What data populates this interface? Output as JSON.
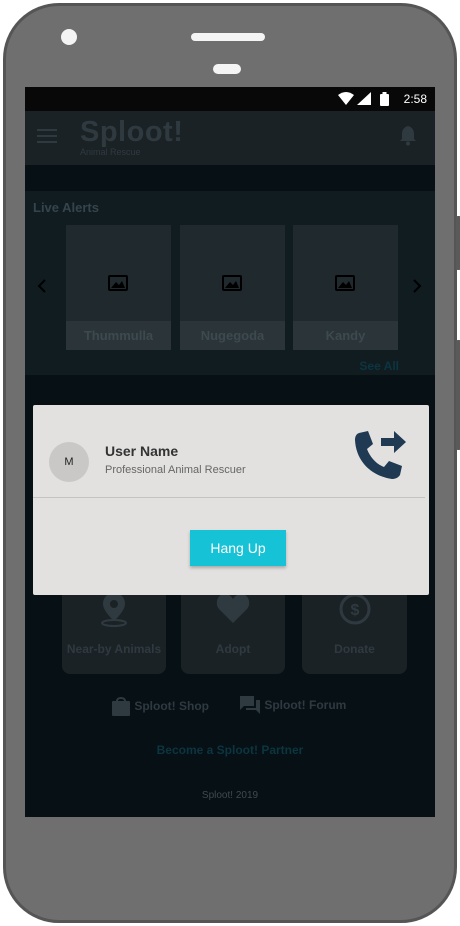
{
  "status_bar": {
    "time": "2:58"
  },
  "app_bar": {
    "title": "Sploot!",
    "subtitle": "Animal Rescue"
  },
  "live_alerts": {
    "title": "Live Alerts",
    "cards": [
      {
        "label": "Thummulla"
      },
      {
        "label": "Nugegoda"
      },
      {
        "label": "Kandy"
      }
    ],
    "see_all": "See All"
  },
  "tiles": [
    {
      "label": "Near-by Animals",
      "icon": "location-pin-icon"
    },
    {
      "label": "Adopt",
      "icon": "heart-icon"
    },
    {
      "label": "Donate",
      "icon": "dollar-icon"
    }
  ],
  "links": {
    "shop": "Sploot! Shop",
    "forum": "Sploot! Forum",
    "partner": "Become a Sploot! Partner"
  },
  "footer": {
    "copyright": "Sploot! 2019"
  },
  "call_dialog": {
    "avatar_initial": "M",
    "user_name": "User Name",
    "user_role": "Professional Animal Rescuer",
    "hang_up_label": "Hang Up",
    "icon": "phone-forwarded-icon"
  },
  "colors": {
    "accent": "#16c3d6",
    "dialog_bg": "#e2e1df",
    "call_icon": "#1f3a52"
  }
}
